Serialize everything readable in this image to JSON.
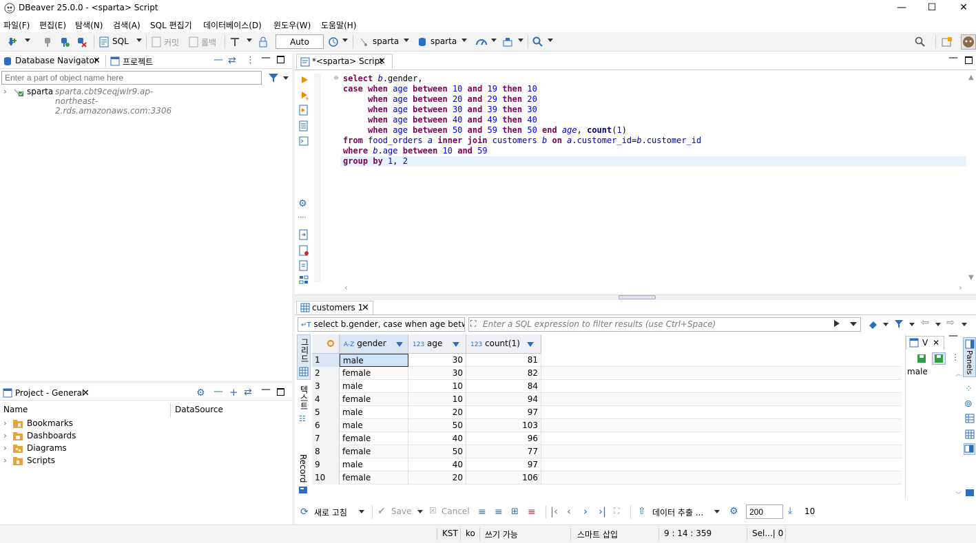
{
  "window": {
    "title": "DBeaver 25.0.0 - <sparta> Script",
    "minimize": "—",
    "maximize": "☐",
    "close": "✕"
  },
  "menu": [
    "파일(F)",
    "편집(E)",
    "탐색(N)",
    "검색(A)",
    "SQL 편집기",
    "데이터베이스(D)",
    "윈도우(W)",
    "도움말(H)"
  ],
  "toolbar": {
    "sql_label": "SQL",
    "commit_label": "커밋",
    "rollback_label": "롤백",
    "tx_mode": "Auto",
    "datasource": "sparta",
    "schema": "sparta"
  },
  "navigator": {
    "tab_label": "Database Navigator",
    "tab2_label": "프로젝트",
    "filter_placeholder": "Enter a part of object name here",
    "connection_name": "sparta",
    "connection_host": "sparta.cbt9ceqjwlr9.ap-northeast-2.rds.amazonaws.com:3306"
  },
  "project": {
    "tab_label": "Project - General",
    "col_name": "Name",
    "col_datasource": "DataSource",
    "items": [
      "Bookmarks",
      "Dashboards",
      "Diagrams",
      "Scripts"
    ]
  },
  "editor": {
    "tab_label": "*<sparta> Script",
    "lines": [
      [
        [
          "kw",
          "select "
        ],
        [
          "al",
          "b"
        ],
        [
          "plain",
          ".gender,"
        ]
      ],
      [
        [
          "kw",
          "case "
        ],
        [
          "kw",
          "when "
        ],
        [
          "id",
          "age "
        ],
        [
          "kw",
          "between "
        ],
        [
          "num",
          "10 "
        ],
        [
          "kw",
          "and "
        ],
        [
          "num",
          "19 "
        ],
        [
          "kw",
          "then "
        ],
        [
          "num",
          "10"
        ]
      ],
      [
        [
          "plain",
          "     "
        ],
        [
          "kw",
          "when "
        ],
        [
          "id",
          "age "
        ],
        [
          "kw",
          "between "
        ],
        [
          "num",
          "20 "
        ],
        [
          "kw",
          "and "
        ],
        [
          "num",
          "29 "
        ],
        [
          "kw",
          "then "
        ],
        [
          "num",
          "20"
        ]
      ],
      [
        [
          "plain",
          "     "
        ],
        [
          "kw",
          "when "
        ],
        [
          "id",
          "age "
        ],
        [
          "kw",
          "between "
        ],
        [
          "num",
          "30 "
        ],
        [
          "kw",
          "and "
        ],
        [
          "num",
          "39 "
        ],
        [
          "kw",
          "then "
        ],
        [
          "num",
          "30"
        ]
      ],
      [
        [
          "plain",
          "     "
        ],
        [
          "kw",
          "when "
        ],
        [
          "id",
          "age "
        ],
        [
          "kw",
          "between "
        ],
        [
          "num",
          "40 "
        ],
        [
          "kw",
          "and "
        ],
        [
          "num",
          "49 "
        ],
        [
          "kw",
          "then "
        ],
        [
          "num",
          "40"
        ]
      ],
      [
        [
          "plain",
          "     "
        ],
        [
          "kw",
          "when "
        ],
        [
          "id",
          "age "
        ],
        [
          "kw",
          "between "
        ],
        [
          "num",
          "50 "
        ],
        [
          "kw",
          "and "
        ],
        [
          "num",
          "59 "
        ],
        [
          "kw",
          "then "
        ],
        [
          "num",
          "50 "
        ],
        [
          "kw",
          "end "
        ],
        [
          "al",
          "age"
        ],
        [
          "plain",
          ", "
        ],
        [
          "kw2",
          "count"
        ],
        [
          "plain",
          "("
        ],
        [
          "num",
          "1"
        ],
        [
          "plain",
          ")"
        ]
      ],
      [
        [
          "kw",
          "from "
        ],
        [
          "id",
          "food_orders "
        ],
        [
          "al",
          "a "
        ],
        [
          "kw",
          "inner join "
        ],
        [
          "id",
          "customers "
        ],
        [
          "al",
          "b "
        ],
        [
          "kw",
          "on "
        ],
        [
          "al",
          "a"
        ],
        [
          "plain",
          "."
        ],
        [
          "id",
          "customer_id"
        ],
        [
          "plain",
          "="
        ],
        [
          "al",
          "b"
        ],
        [
          "plain",
          "."
        ],
        [
          "id",
          "customer_id"
        ]
      ],
      [
        [
          "kw",
          "where "
        ],
        [
          "al",
          "b"
        ],
        [
          "plain",
          "."
        ],
        [
          "id",
          "age "
        ],
        [
          "kw",
          "between "
        ],
        [
          "num",
          "10 "
        ],
        [
          "kw",
          "and "
        ],
        [
          "num",
          "59"
        ]
      ],
      [
        [
          "kw",
          "group by "
        ],
        [
          "num",
          "1"
        ],
        [
          "plain",
          ", "
        ],
        [
          "num",
          "2"
        ]
      ]
    ]
  },
  "results": {
    "tab_label": "customers 1",
    "sql_preview": "select b.gender, case when age between 1",
    "filter_placeholder": "Enter a SQL expression to filter results (use Ctrl+Space)",
    "side_tabs": [
      "그리드",
      "텍스트",
      "Record"
    ],
    "columns": [
      {
        "type": "A-Z",
        "name": "gender"
      },
      {
        "type": "123",
        "name": "age"
      },
      {
        "type": "123",
        "name": "count(1)"
      }
    ],
    "rows": [
      [
        "1",
        "male",
        "30",
        "81"
      ],
      [
        "2",
        "female",
        "30",
        "82"
      ],
      [
        "3",
        "male",
        "10",
        "84"
      ],
      [
        "4",
        "female",
        "10",
        "94"
      ],
      [
        "5",
        "male",
        "20",
        "97"
      ],
      [
        "6",
        "male",
        "50",
        "103"
      ],
      [
        "7",
        "female",
        "40",
        "96"
      ],
      [
        "8",
        "female",
        "50",
        "77"
      ],
      [
        "9",
        "male",
        "40",
        "97"
      ],
      [
        "10",
        "female",
        "20",
        "106"
      ]
    ],
    "value_panel": {
      "tab_label": "V",
      "value": "male",
      "panels_label": "Panels"
    },
    "bottom": {
      "refresh": "새로 고침",
      "save": "Save",
      "cancel": "Cancel",
      "export": "데이터 추출 ...",
      "fetch_size": "200",
      "row_count": "10"
    }
  },
  "status": {
    "tz": "KST",
    "locale": "ko",
    "mode": "쓰기 가능",
    "insert": "스마트 삽입",
    "pos": "9 : 14 : 359",
    "sel": "Sel...| 0"
  },
  "colors": {
    "keyword": "#7f0055",
    "number": "#0000ff",
    "identifier": "#0000c0",
    "header_bg": "#eef0f5",
    "selected_cell": "#cfe3f7"
  }
}
